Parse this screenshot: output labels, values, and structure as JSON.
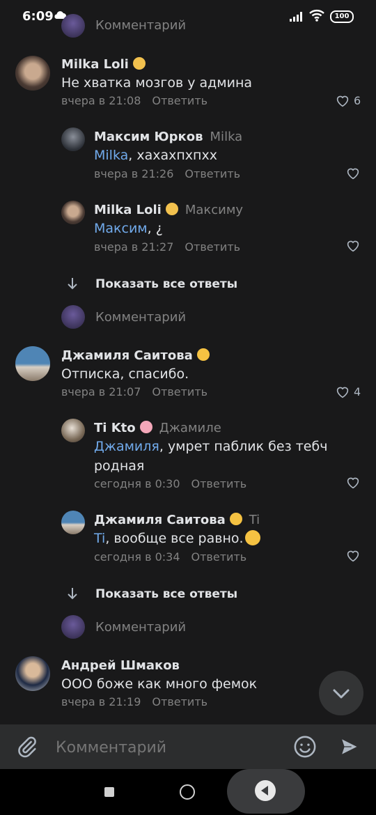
{
  "status": {
    "time": "6:09",
    "battery": "100"
  },
  "top_partial": {
    "label": "Комментарий"
  },
  "comments": [
    {
      "name": "Milka Loli",
      "text": "Не хватка мозгов у админа",
      "time": "вчера в 21:08",
      "reply": "Ответить",
      "likes": "6"
    },
    {
      "name": "Джамиля Саитова",
      "text": "Отписка, спасибо.",
      "time": "вчера в 21:07",
      "reply": "Ответить",
      "likes": "4"
    },
    {
      "name": "Андрей Шмаков",
      "text": "ООО боже как много фемок",
      "time": "вчера в 21:19",
      "reply": "Ответить"
    }
  ],
  "replies": [
    {
      "name": "Максим Юрков",
      "to": "Milka",
      "mention": "Milka",
      "text": ", хахахпхпхх",
      "time": "вчера в 21:26",
      "reply": "Ответить"
    },
    {
      "name": "Milka Loli",
      "to": "Максиму",
      "mention": "Максим",
      "text": ", ¿",
      "time": "вчера в 21:27",
      "reply": "Ответить"
    },
    {
      "name": "Ti Kto",
      "to": "Джамиле",
      "mention": "Джамиля",
      "text": ", умрет паблик без тебч",
      "text2": "родная",
      "time": "сегодня в 0:30",
      "reply": "Ответить"
    },
    {
      "name": "Джамиля Саитова",
      "to": "Ti",
      "mention": "Ti",
      "text": ", вообще все равно.",
      "time": "сегодня в 0:34",
      "reply": "Ответить"
    }
  ],
  "show_all": "Показать все ответы",
  "comment_placeholder": "Комментарий",
  "input": {
    "placeholder": "Комментарий"
  },
  "icons": [
    "paperclip-icon",
    "smile-icon",
    "send-icon",
    "chevron-down-icon",
    "heart-icon",
    "arrow-down-icon"
  ],
  "colors": {
    "background": "#19191a",
    "mention": "#71aaeb",
    "secondary": "#828282"
  }
}
